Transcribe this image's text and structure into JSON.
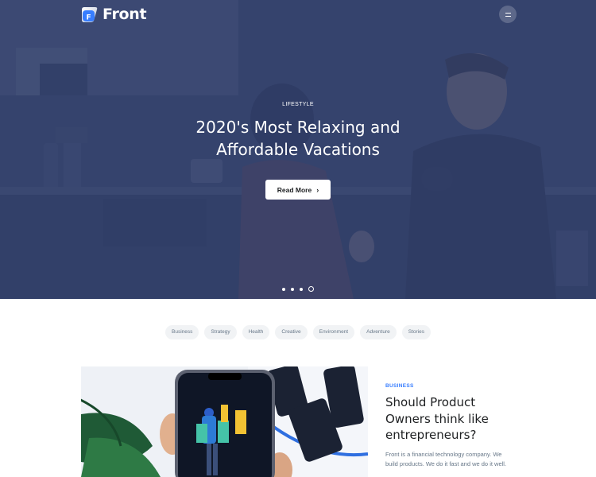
{
  "brand": {
    "name": "Front",
    "logo_letter": "F"
  },
  "nav": {
    "menu_icon": "hamburger-icon"
  },
  "hero": {
    "eyebrow": "LIFESTYLE",
    "title": "2020's Most Relaxing and Affordable Vacations",
    "button_label": "Read More",
    "button_icon": "chevron-right-icon",
    "overlay_color": "#31406c",
    "slides_count": 4,
    "active_slide": 4
  },
  "tags": [
    "Business",
    "Strategy",
    "Health",
    "Creative",
    "Environment",
    "Adventure",
    "Stories"
  ],
  "featured_article": {
    "category": "BUSINESS",
    "title": "Should Product Owners think like entrepreneurs?",
    "description": "Front is a financial technology company. We build products. We do it fast and we do it well.",
    "accent_color": "#377dff"
  }
}
